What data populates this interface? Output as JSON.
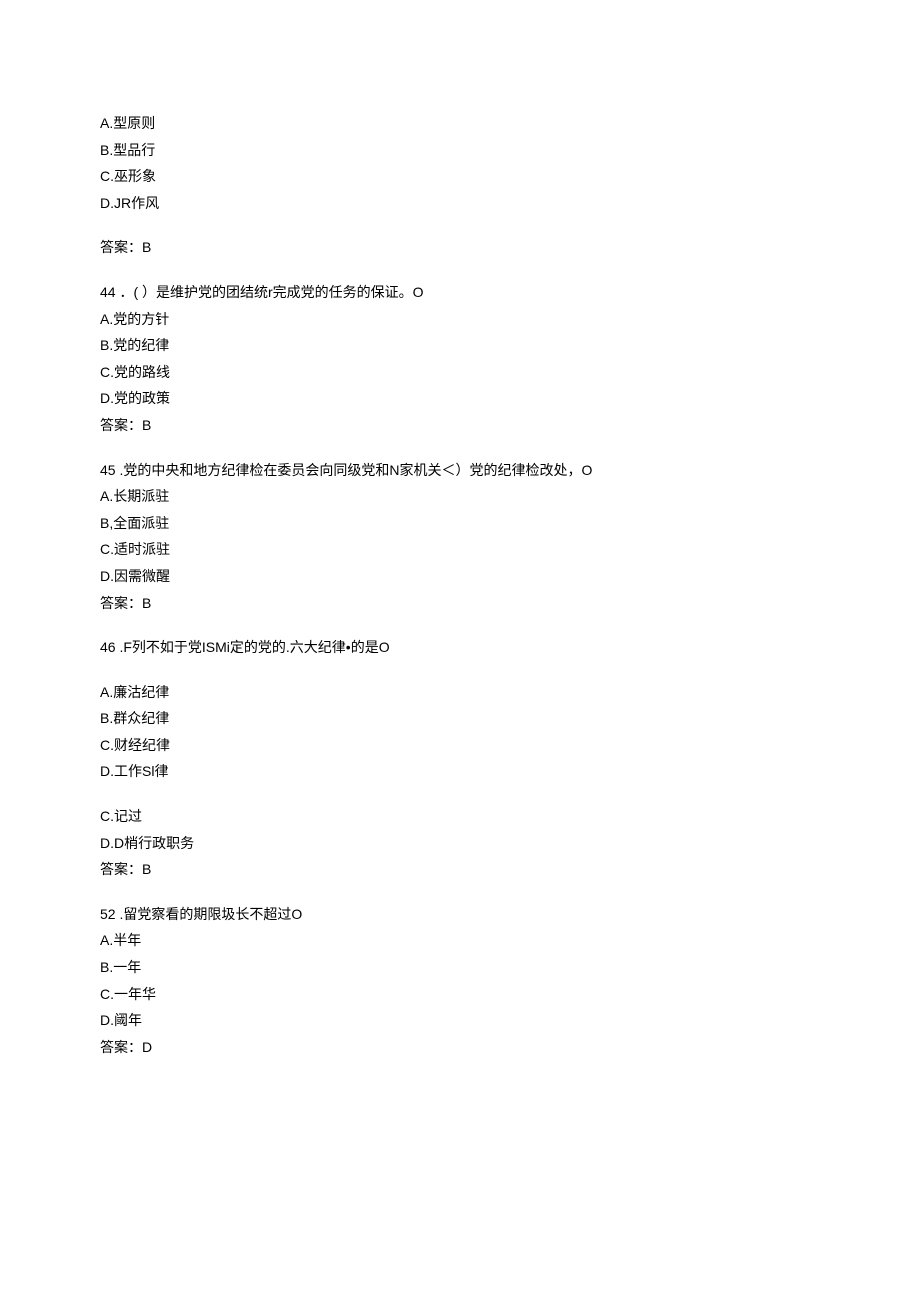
{
  "lines": [
    {
      "text": "A.型原则",
      "name": "q43-option-a"
    },
    {
      "text": "B.型品行",
      "name": "q43-option-b"
    },
    {
      "text": "C.巫形象",
      "name": "q43-option-c"
    },
    {
      "text": "D.JR作风",
      "name": "q43-option-d"
    },
    {
      "spacer": true
    },
    {
      "text": "答案：B",
      "name": "q43-answer"
    },
    {
      "spacer": true
    },
    {
      "text": "44 ．( ）是维护党的团结统r完成党的任务的保证。O",
      "name": "q44-question"
    },
    {
      "text": "A.党的方针",
      "name": "q44-option-a"
    },
    {
      "text": "B.党的纪律",
      "name": "q44-option-b"
    },
    {
      "text": "C.党的路线",
      "name": "q44-option-c"
    },
    {
      "text": "D.党的政策",
      "name": "q44-option-d"
    },
    {
      "text": "答案：B",
      "name": "q44-answer"
    },
    {
      "spacer": true
    },
    {
      "text": "45   .党的中央和地方纪律检在委员会向同级党和N家机关＜）党的纪律检改处，O",
      "name": "q45-question"
    },
    {
      "text": "A.长期派驻",
      "name": "q45-option-a"
    },
    {
      "text": "B,全面派驻",
      "name": "q45-option-b"
    },
    {
      "text": "C.适时派驻",
      "name": "q45-option-c"
    },
    {
      "text": "D.因需微醒",
      "name": "q45-option-d"
    },
    {
      "text": "答案：B",
      "name": "q45-answer"
    },
    {
      "spacer": true
    },
    {
      "text": "46   .F列不如于党ISMi定的党的.六大纪律•的是O",
      "name": "q46-question"
    },
    {
      "spacer": true
    },
    {
      "text": "A.廉沽纪律",
      "name": "q46-option-a"
    },
    {
      "text": "B.群众纪律",
      "name": "q46-option-b"
    },
    {
      "text": "C.财经纪律",
      "name": "q46-option-c"
    },
    {
      "text": "D.工作Sl律",
      "name": "q46-option-d"
    },
    {
      "spacer": true
    },
    {
      "text": "C.记过",
      "name": "q51-option-c"
    },
    {
      "text": "D.D梢行政职务",
      "name": "q51-option-d"
    },
    {
      "text": "答案：B",
      "name": "q51-answer"
    },
    {
      "spacer": true
    },
    {
      "text": "52   .留党察看的期限圾长不超过O",
      "name": "q52-question"
    },
    {
      "text": "A.半年",
      "name": "q52-option-a"
    },
    {
      "text": "B.一年",
      "name": "q52-option-b"
    },
    {
      "text": "C.一年华",
      "name": "q52-option-c"
    },
    {
      "text": "D.阈年",
      "name": "q52-option-d"
    },
    {
      "text": "答案：D",
      "name": "q52-answer"
    }
  ]
}
